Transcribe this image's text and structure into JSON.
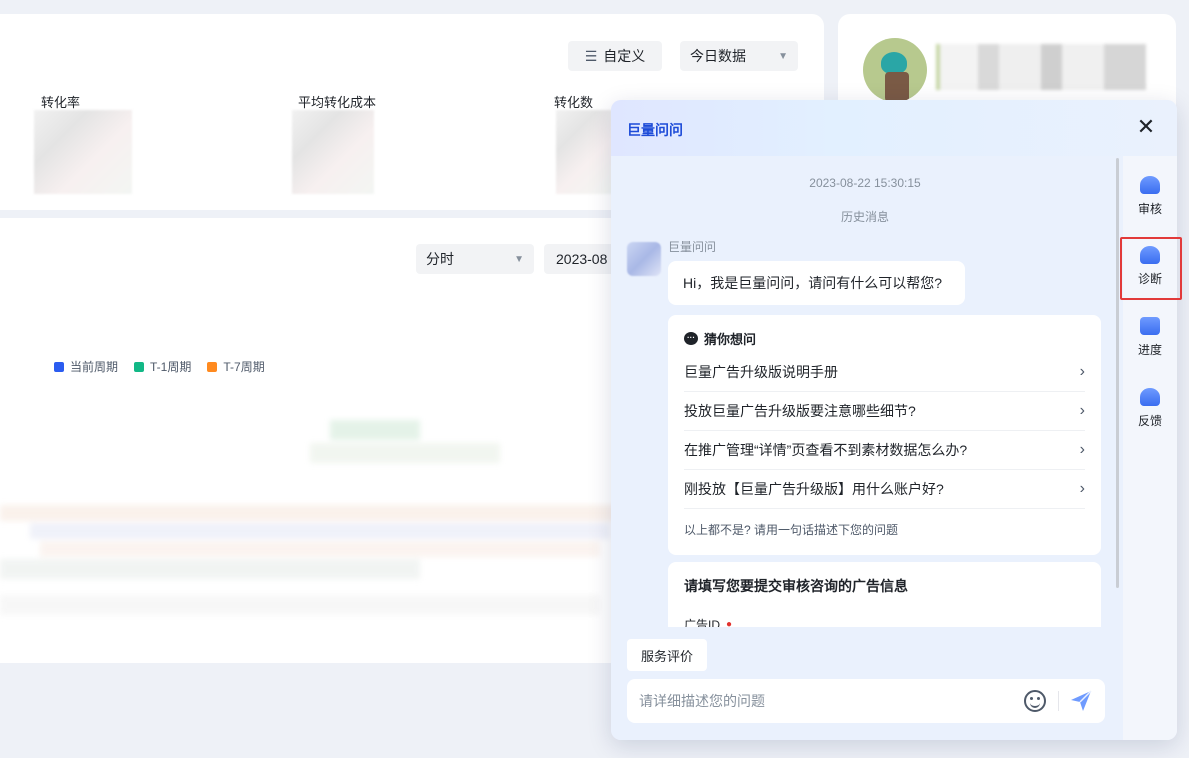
{
  "dashboard": {
    "custom_label": "自定义",
    "today_label": "今日数据",
    "metrics": [
      "转化率",
      "平均转化成本",
      "转化数"
    ],
    "interval_label": "分时",
    "date_value": "2023-08",
    "legend": [
      {
        "label": "当前周期",
        "color": "#2b5cf0"
      },
      {
        "label": "T-1周期",
        "color": "#12b886"
      },
      {
        "label": "T-7周期",
        "color": "#ff8a1f"
      }
    ]
  },
  "chat": {
    "title": "巨量问问",
    "timestamp": "2023-08-22 15:30:15",
    "history_label": "历史消息",
    "bot_name": "巨量问问",
    "greeting": "Hi，我是巨量问问，请问有什么可以帮您?",
    "guess_title": "猜你想问",
    "questions": [
      "巨量广告升级版说明手册",
      "投放巨量广告升级版要注意哪些细节?",
      "在推广管理“详情”页查看不到素材数据怎么办?",
      "刚投放【巨量广告升级版】用什么账户好?"
    ],
    "hint": "以上都不是? 请用一句话描述下您的问题",
    "form_title": "请填写您要提交审核咨询的广告信息",
    "form_field": "广告ID",
    "rate_label": "服务评价",
    "input_placeholder": "请详细描述您的问题"
  },
  "rail": {
    "items": [
      {
        "label": "审核",
        "icon": "review-icon"
      },
      {
        "label": "诊断",
        "icon": "diagnose-icon"
      },
      {
        "label": "进度",
        "icon": "progress-icon"
      },
      {
        "label": "反馈",
        "icon": "feedback-icon"
      }
    ]
  }
}
